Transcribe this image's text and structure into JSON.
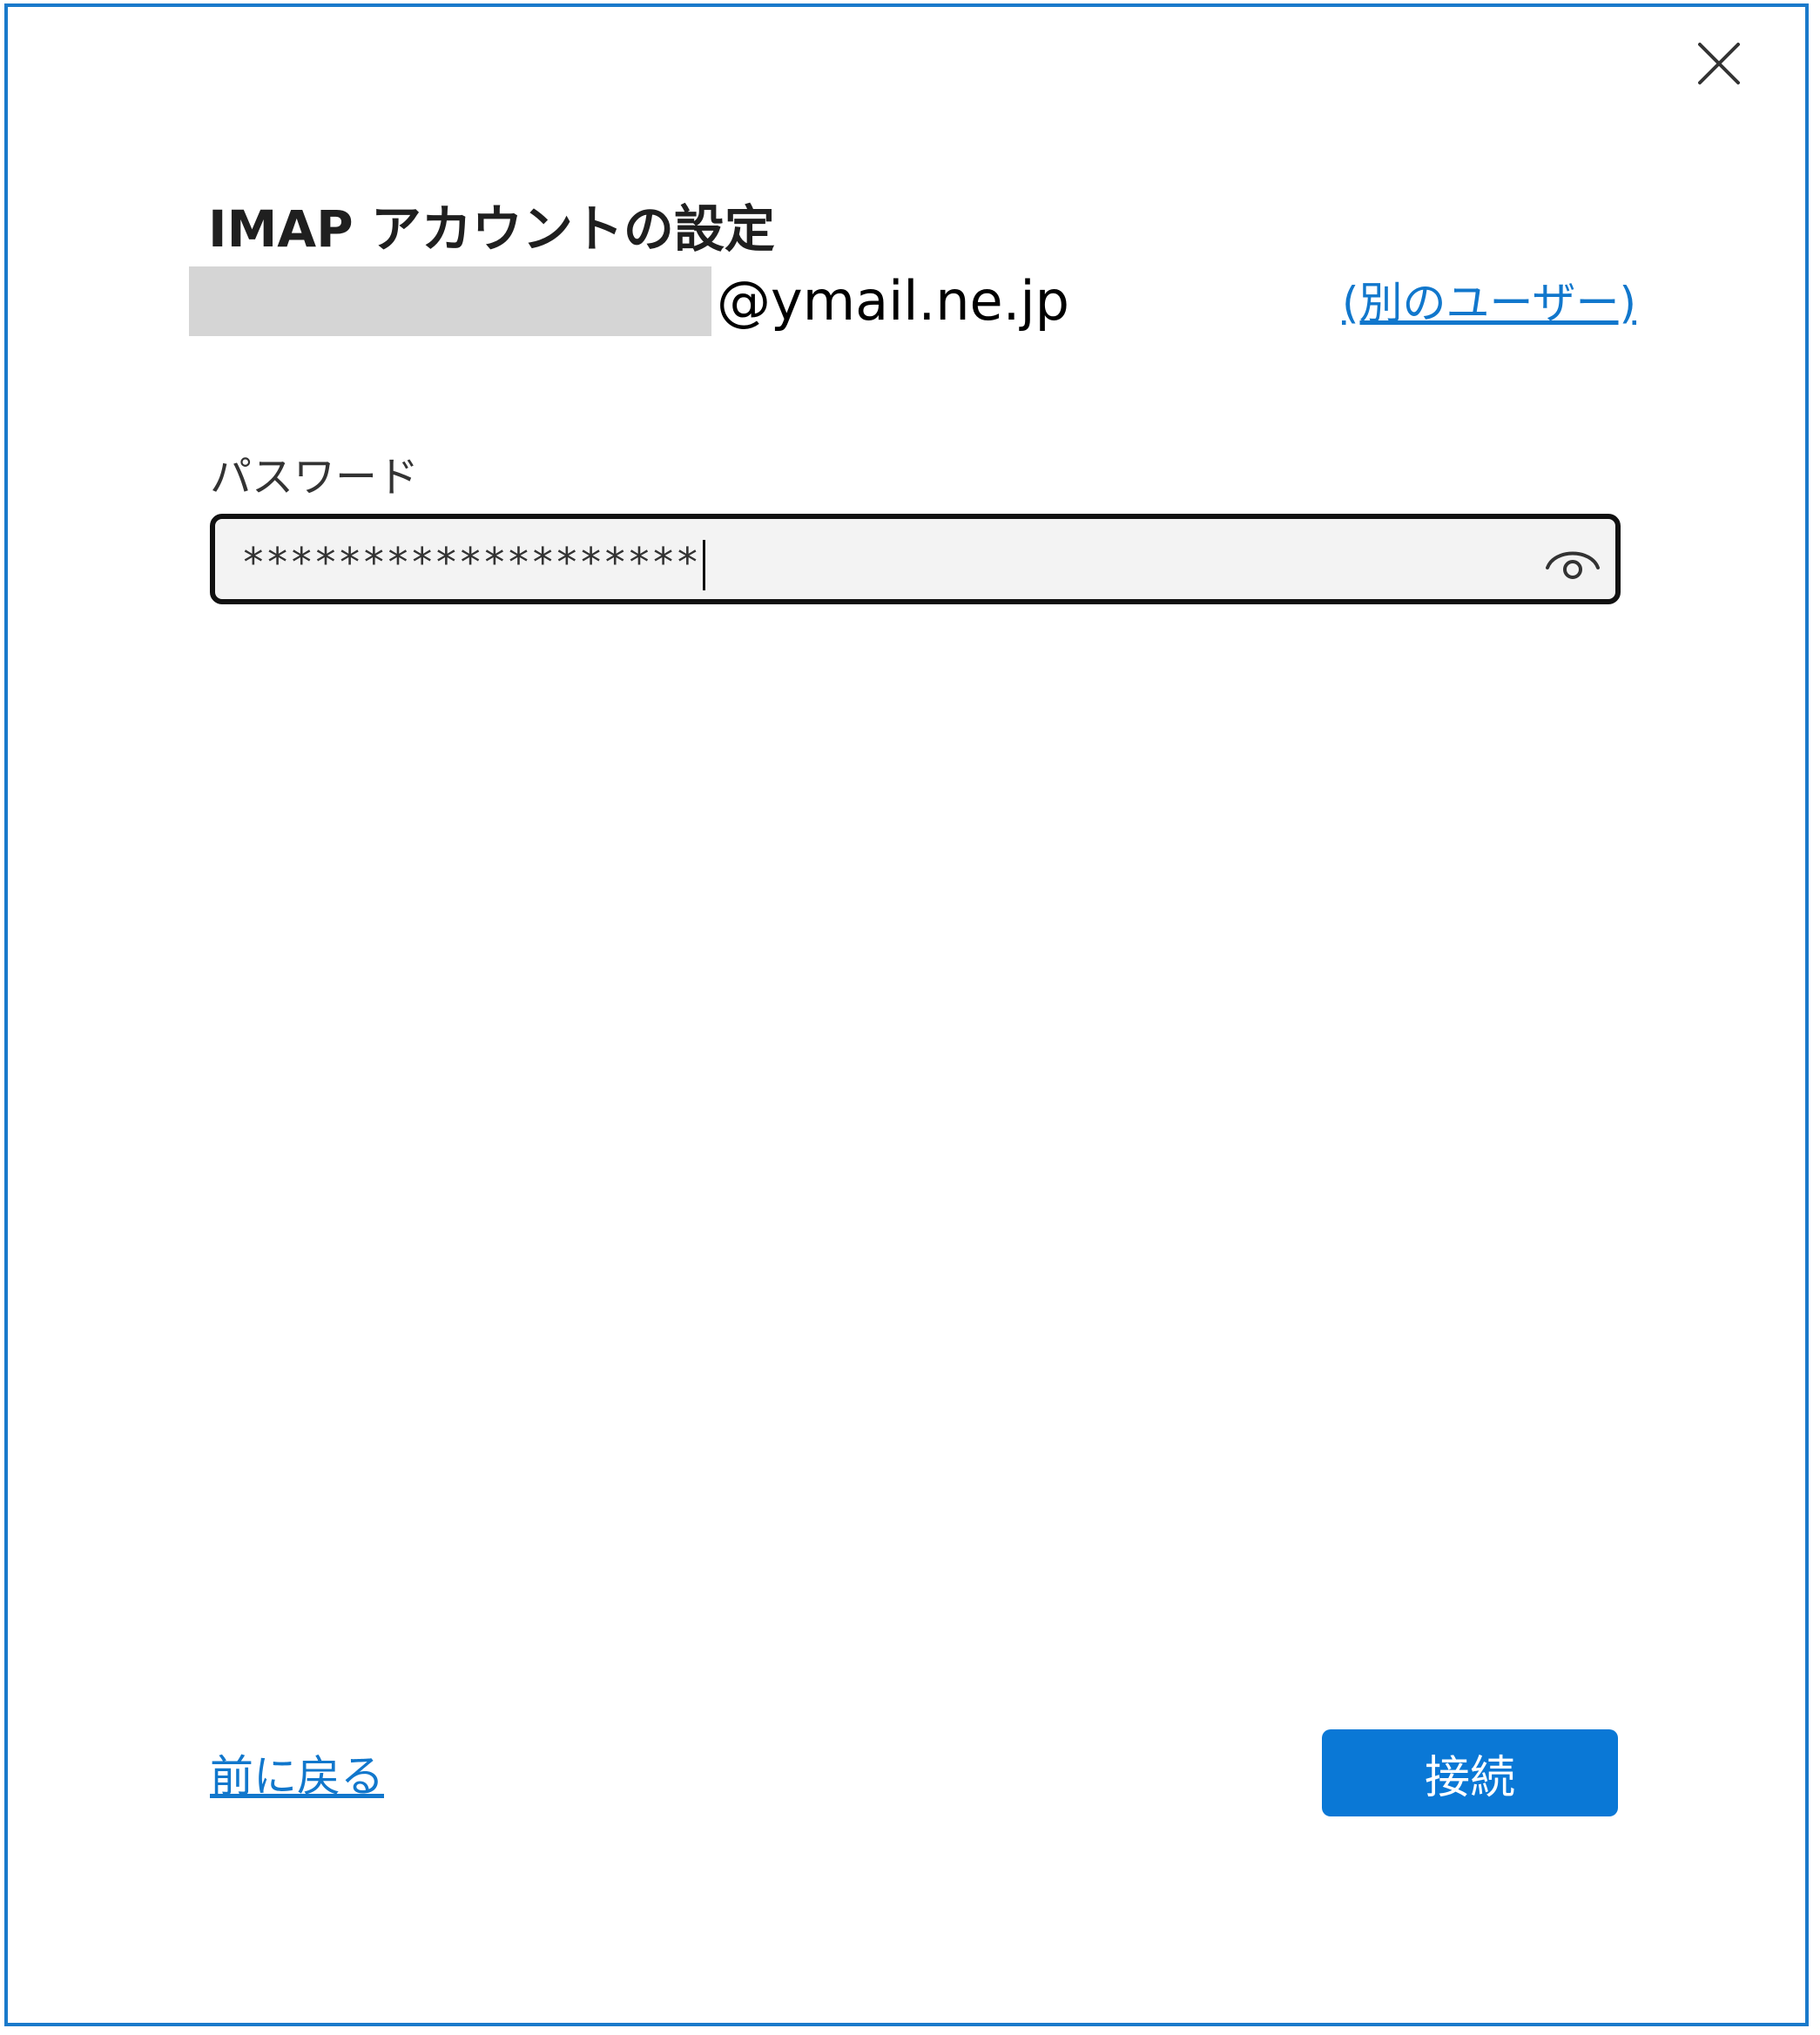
{
  "dialog": {
    "title": "IMAP アカウントの設定",
    "email_domain": "@ymail.ne.jp",
    "switch_user_label": "(別のユーザー)",
    "password_label": "パスワード",
    "password_value": "*******************",
    "back_label": "前に戻る",
    "connect_label": "接続"
  },
  "icons": {
    "close": "close-icon",
    "reveal_password": "eye-icon"
  },
  "colors": {
    "accent": "#0a78d6",
    "link": "#1177cc",
    "border": "#1a7acb"
  }
}
